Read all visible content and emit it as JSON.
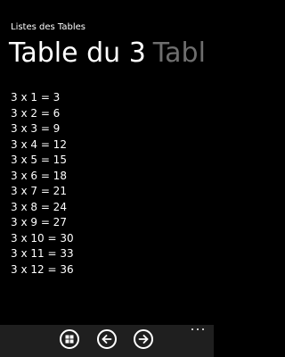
{
  "app": {
    "title": "Listes des Tables"
  },
  "pivot": {
    "headers": [
      {
        "label": "Table du 3",
        "active": true
      },
      {
        "label": "Tabl",
        "active": false
      }
    ]
  },
  "table": {
    "lines": [
      "3 x 1 = 3",
      "3 x 2 = 6",
      "3 x 3 = 9",
      "3 x 4 = 12",
      "3 x 5 = 15",
      "3 x 6 = 18",
      "3 x 7 = 21",
      "3 x 8 = 24",
      "3 x 9 = 27",
      "3 x 10 = 30",
      "3 x 11 = 33",
      "3 x 12 = 36"
    ]
  },
  "app_bar": {
    "buttons": [
      {
        "icon": "grid-icon",
        "name": "home-button"
      },
      {
        "icon": "arrow-left-icon",
        "name": "previous-button"
      },
      {
        "icon": "arrow-right-icon",
        "name": "next-button"
      }
    ],
    "more_icon": "ellipsis-icon"
  },
  "colors": {
    "background": "#000000",
    "text": "#ffffff",
    "inactive_header": "#6e6e6e",
    "app_bar": "#1f1f1f"
  }
}
